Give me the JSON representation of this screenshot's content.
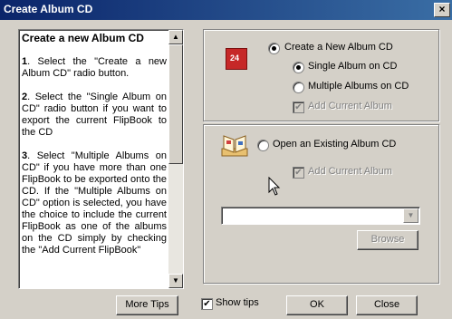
{
  "window": {
    "title": "Create Album CD",
    "close_label": "×"
  },
  "tips": {
    "heading": "Create a new Album CD",
    "steps": [
      {
        "num": "1",
        "text": ". Select the \"Create a new Album CD\" radio button."
      },
      {
        "num": "2",
        "text": ". Select the \"Single Album on CD\" radio button if you want to export the current FlipBook to the CD"
      },
      {
        "num": "3",
        "text": ". Select \"Multiple Albums on CD\" if you have more than one FlipBook to be exported onto the CD. If the \"Multiple Albums on CD\" option is selected, you have the choice to include the current FlipBook as one of the albums on the CD simply by checking the \"Add Current FlipBook\""
      }
    ],
    "scroll_up": "▲",
    "scroll_down": "▼",
    "more_tips_label": "More Tips"
  },
  "create_group": {
    "create_new_label": "Create a New Album CD",
    "single_label": "Single Album on CD",
    "multiple_label": "Multiple Albums on CD",
    "add_current_label": "Add Current Album",
    "add_current_check": "✔"
  },
  "open_group": {
    "open_existing_label": "Open an Existing Album CD",
    "add_current_label": "Add Current Album",
    "add_current_check": "✔",
    "path_value": "",
    "dropdown_arrow": "▼",
    "browse_label": "Browse"
  },
  "footer": {
    "show_tips_label": "Show tips",
    "show_tips_check": "✔",
    "ok_label": "OK",
    "close_label": "Close"
  },
  "icons": {
    "album_icon_text": "24"
  },
  "colors": {
    "titlebar": "#0a246a",
    "face": "#d4d0c8",
    "album_icon": "#c62828"
  }
}
